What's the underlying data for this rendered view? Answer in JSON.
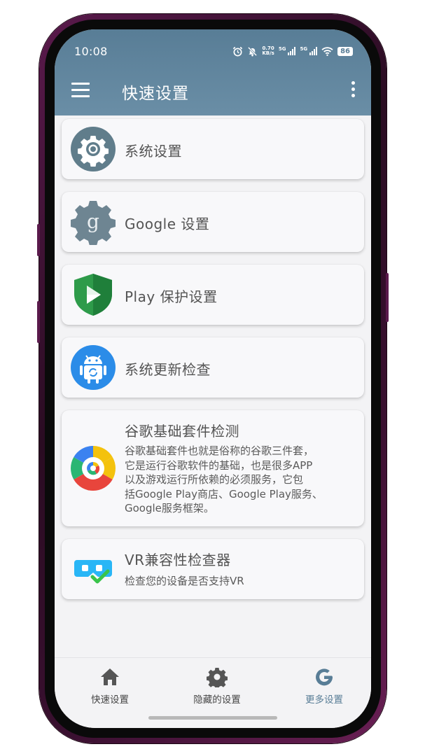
{
  "status_bar": {
    "time": "10:08",
    "net_speed_value": "0.70",
    "net_speed_unit": "KB/s",
    "sim1_label": "5G",
    "sim2_label": "5G",
    "battery": "86"
  },
  "app_bar": {
    "title": "快速设置"
  },
  "cards": [
    {
      "id": "system-settings",
      "label": "系统设置",
      "icon": "gear-icon"
    },
    {
      "id": "google-settings",
      "label": "Google 设置",
      "icon": "google-gear-icon"
    },
    {
      "id": "play-protect",
      "label": "Play 保护设置",
      "icon": "play-protect-shield-icon"
    },
    {
      "id": "system-update",
      "label": "系统更新检查",
      "icon": "android-update-icon"
    },
    {
      "id": "gms-check",
      "label": "谷歌基础套件检测",
      "icon": "google-services-icon",
      "description": "谷歌基础套件也就是俗称的谷歌三件套，\n它是运行谷歌软件的基础，也是很多APP\n以及游戏运行所依赖的必须服务，它包\n括Google Play商店、Google Play服务、\nGoogle服务框架。"
    },
    {
      "id": "vr-check",
      "label": "VR兼容性检查器",
      "icon": "vr-headset-check-icon",
      "description": "检查您的设备是否支持VR"
    }
  ],
  "bottom_nav": {
    "items": [
      {
        "label": "快速设置",
        "icon": "home-icon",
        "active": false
      },
      {
        "label": "隐藏的设置",
        "icon": "gear-icon",
        "active": false
      },
      {
        "label": "更多设置",
        "icon": "google-g-icon",
        "active": true
      }
    ]
  },
  "colors": {
    "primary": "#587d96",
    "background": "#f3f3f5",
    "card": "#f8f8fa",
    "text": "#545454"
  }
}
